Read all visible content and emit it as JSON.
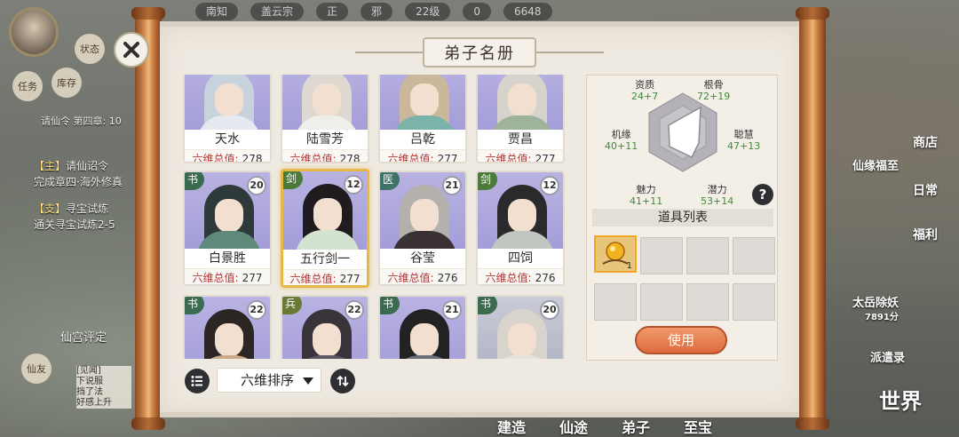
{
  "background": {
    "top_pills": [
      "南知",
      "盖云宗",
      "正",
      "邪",
      "22级",
      "0",
      "6648"
    ],
    "left_buttons": {
      "status": "状态",
      "tasks": "任务",
      "stock": "库存"
    },
    "chapter": {
      "icon_label": "请仙令",
      "chapter_text": "第四章:",
      "progress": "10"
    },
    "quests": [
      {
        "tag": "【主】",
        "title": "请仙诏令",
        "desc": "完成章四·海外修真"
      },
      {
        "tag": "【支】",
        "title": "寻宝试炼",
        "desc": "通关寻宝试炼2-5"
      }
    ],
    "palace_rating": "仙宫评定",
    "friends": "仙友",
    "chat_lines": [
      "[见闻]",
      "下说服",
      "挡了法",
      "好感上升"
    ],
    "right_buttons": {
      "shop": "商店",
      "daily": "日常",
      "welfare": "福利",
      "gift": "仙缘福至",
      "boss": "太岳除妖",
      "boss_score": "7891分",
      "dispatch": "派遣录",
      "world": "世界"
    },
    "bottom_nav": [
      "建造",
      "仙途",
      "弟子",
      "至宝"
    ]
  },
  "dialog": {
    "title": "弟子名册",
    "sort_label": "六维排序",
    "stat_label": "六维总值:",
    "disciples": [
      {
        "name": "天水",
        "total": "278",
        "level": "",
        "type": ""
      },
      {
        "name": "陆雪芳",
        "total": "278",
        "level": "",
        "type": ""
      },
      {
        "name": "吕乾",
        "total": "277",
        "level": "",
        "type": ""
      },
      {
        "name": "贾昌",
        "total": "277",
        "level": "",
        "type": ""
      },
      {
        "name": "白景胜",
        "total": "277",
        "level": "20",
        "type": "书"
      },
      {
        "name": "五行剑一",
        "total": "277",
        "level": "12",
        "type": "剑"
      },
      {
        "name": "谷莹",
        "total": "276",
        "level": "21",
        "type": "医"
      },
      {
        "name": "四饲",
        "total": "276",
        "level": "12",
        "type": "剑"
      },
      {
        "name": "",
        "total": "",
        "level": "22",
        "type": "书"
      },
      {
        "name": "",
        "total": "",
        "level": "22",
        "type": "兵"
      },
      {
        "name": "",
        "total": "",
        "level": "21",
        "type": "书"
      },
      {
        "name": "",
        "total": "",
        "level": "20",
        "type": "书"
      }
    ],
    "radar": {
      "stats": [
        {
          "name": "资质",
          "value": "24+7"
        },
        {
          "name": "根骨",
          "value": "72+19"
        },
        {
          "name": "聪慧",
          "value": "47+13"
        },
        {
          "name": "潜力",
          "value": "53+14"
        },
        {
          "name": "魅力",
          "value": "41+11"
        },
        {
          "name": "机缘",
          "value": "40+11"
        }
      ]
    },
    "items_title": "道具列表",
    "items": [
      {
        "count": "1"
      }
    ],
    "use_button": "使用"
  },
  "colors": {
    "accent_selected": "#e8b74a",
    "use_button": "#dd6b3f",
    "stat_green": "#3f8a3a",
    "stat_label_red": "#b43434"
  }
}
